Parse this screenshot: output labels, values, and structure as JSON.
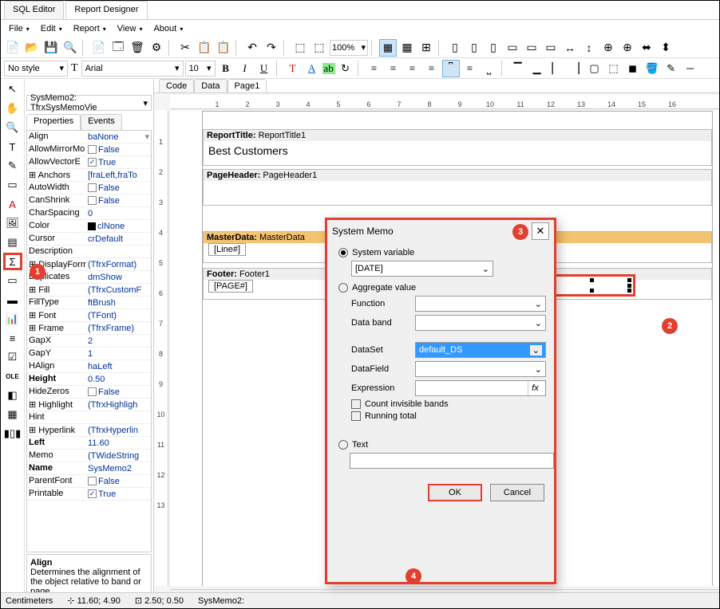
{
  "app_tabs": [
    "SQL Editor",
    "Report Designer"
  ],
  "active_app_tab": 1,
  "menus": [
    "File",
    "Edit",
    "Report",
    "View",
    "About"
  ],
  "zoom": "100%",
  "format": {
    "style": "No style",
    "font": "Arial",
    "size": "10"
  },
  "top_tabs": [
    "Code",
    "Data",
    "Page1"
  ],
  "active_top_tab": 2,
  "object_selector": "SysMemo2: TfrxSysMemoVie",
  "prop_tabs": [
    "Properties",
    "Events"
  ],
  "properties": [
    {
      "n": "Align",
      "v": "baNone",
      "dd": true
    },
    {
      "n": "AllowMirrorMo",
      "v": "False",
      "chk": false
    },
    {
      "n": "AllowVectorE",
      "v": "True",
      "chk": true
    },
    {
      "n": "Anchors",
      "v": "[fraLeft,fraTo",
      "exp": true
    },
    {
      "n": "AutoWidth",
      "v": "False",
      "chk": false
    },
    {
      "n": "CanShrink",
      "v": "False",
      "chk": false
    },
    {
      "n": "CharSpacing",
      "v": "0"
    },
    {
      "n": "Color",
      "v": "clNone",
      "swatch": "#000"
    },
    {
      "n": "Cursor",
      "v": "crDefault"
    },
    {
      "n": "Description",
      "v": ""
    },
    {
      "n": "DisplayFormat",
      "v": "(TfrxFormat)",
      "exp": true
    },
    {
      "n": "Duplicates",
      "v": "dmShow"
    },
    {
      "n": "Fill",
      "v": "(TfrxCustomF",
      "exp": true
    },
    {
      "n": "FillType",
      "v": "ftBrush"
    },
    {
      "n": "Font",
      "v": "(TFont)",
      "exp": true
    },
    {
      "n": "Frame",
      "v": "(TfrxFrame)",
      "exp": true
    },
    {
      "n": "GapX",
      "v": "2"
    },
    {
      "n": "GapY",
      "v": "1"
    },
    {
      "n": "HAlign",
      "v": "haLeft"
    },
    {
      "n": "Height",
      "v": "0.50",
      "bold": true
    },
    {
      "n": "HideZeros",
      "v": "False",
      "chk": false
    },
    {
      "n": "Highlight",
      "v": "(TfrxHighligh",
      "exp": true
    },
    {
      "n": "Hint",
      "v": ""
    },
    {
      "n": "Hyperlink",
      "v": "(TfrxHyperlin",
      "exp": true
    },
    {
      "n": "Left",
      "v": "11.60",
      "bold": true
    },
    {
      "n": "Memo",
      "v": "(TWideString"
    },
    {
      "n": "Name",
      "v": "SysMemo2",
      "bold": true
    },
    {
      "n": "ParentFont",
      "v": "False",
      "chk": false
    },
    {
      "n": "Printable",
      "v": "True",
      "chk": true
    }
  ],
  "help": {
    "title": "Align",
    "desc": "Determines the alignment of the object relative to band or page"
  },
  "hruler": [
    "1",
    "2",
    "3",
    "4",
    "5",
    "6",
    "7",
    "8",
    "9",
    "10",
    "11",
    "12",
    "13",
    "14",
    "15",
    "16"
  ],
  "vruler": [
    "1",
    "2",
    "3",
    "4",
    "5",
    "6",
    "7",
    "8",
    "9",
    "10",
    "11",
    "12",
    "13"
  ],
  "bands": {
    "report_title": {
      "label": "ReportTitle:",
      "name": "ReportTitle1",
      "text": "Best Customers"
    },
    "page_header": {
      "label": "PageHeader:",
      "name": "PageHeader1"
    },
    "master_data": {
      "label": "MasterData:",
      "name": "MasterData",
      "line": "[Line#]"
    },
    "footer": {
      "label": "Footer:",
      "name": "Footer1",
      "page": "[PAGE#]"
    }
  },
  "dialog": {
    "title": "System Memo",
    "radio_sys": "System variable",
    "sys_value": "[DATE]",
    "radio_agg": "Aggregate value",
    "rows": {
      "function": "Function",
      "databand": "Data band",
      "dataset": "DataSet",
      "datafield": "DataField",
      "expression": "Expression"
    },
    "dataset_value": "default_DS",
    "check_invisible": "Count invisible bands",
    "check_running": "Running total",
    "radio_text": "Text",
    "btn_ok": "OK",
    "btn_cancel": "Cancel",
    "fx": "fx"
  },
  "status": {
    "units": "Centimeters",
    "pos": "11.60; 4.90",
    "size": "2.50; 0.50",
    "obj": "SysMemo2:"
  },
  "badges": {
    "b1": "1",
    "b2": "2",
    "b3": "3",
    "b4": "4"
  },
  "chevron": "▾"
}
